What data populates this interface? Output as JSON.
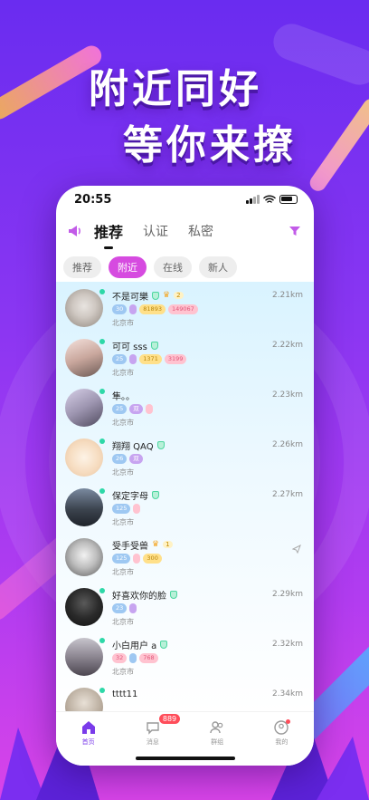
{
  "headline": {
    "line1": "附近同好",
    "line2": "等你来撩"
  },
  "status": {
    "time": "20:55"
  },
  "nav": {
    "tabs": [
      {
        "label": "推荐",
        "active": true
      },
      {
        "label": "认证",
        "active": false
      },
      {
        "label": "私密",
        "active": false
      }
    ]
  },
  "filters": [
    {
      "label": "推荐",
      "active": false
    },
    {
      "label": "附近",
      "active": true
    },
    {
      "label": "在线",
      "active": false
    },
    {
      "label": "新人",
      "active": false
    }
  ],
  "users": [
    {
      "name": "不是可樂",
      "city": "北京市",
      "distance": "2.21km",
      "level": "2",
      "badges": [
        "30",
        "",
        "81893",
        "149067"
      ]
    },
    {
      "name": "可可 sss",
      "city": "北京市",
      "distance": "2.22km",
      "badges": [
        "25",
        "",
        "1371",
        "3199"
      ]
    },
    {
      "name": "隼。。",
      "city": "北京市",
      "distance": "2.23km",
      "badges": [
        "25",
        "双",
        ""
      ]
    },
    {
      "name": "翔翔 QAQ",
      "city": "北京市",
      "distance": "2.26km",
      "badges": [
        "26",
        "双"
      ]
    },
    {
      "name": "保定字母",
      "city": "北京市",
      "distance": "2.27km",
      "badges": [
        "125",
        ""
      ]
    },
    {
      "name": "受手受兽",
      "city": "北京市",
      "distance": "",
      "level": "1",
      "badges": [
        "125",
        "",
        "300"
      ]
    },
    {
      "name": "好喜欢你的脸",
      "city": "北京市",
      "distance": "2.29km",
      "badges": [
        "23",
        ""
      ]
    },
    {
      "name": "小白用户 a",
      "city": "北京市",
      "distance": "2.32km",
      "badges": [
        "32",
        "",
        "768"
      ]
    },
    {
      "name": "tttt11",
      "city": "",
      "distance": "2.34km",
      "badges": []
    }
  ],
  "tabbar": [
    {
      "label": "首页",
      "icon": "home-icon",
      "active": true
    },
    {
      "label": "消息",
      "icon": "message-icon",
      "badge": "889"
    },
    {
      "label": "群组",
      "icon": "group-icon"
    },
    {
      "label": "我的",
      "icon": "profile-icon"
    }
  ],
  "colors": {
    "accent": "#d64be0",
    "tab_active": "#7a3bea",
    "online": "#2ed8a8"
  }
}
